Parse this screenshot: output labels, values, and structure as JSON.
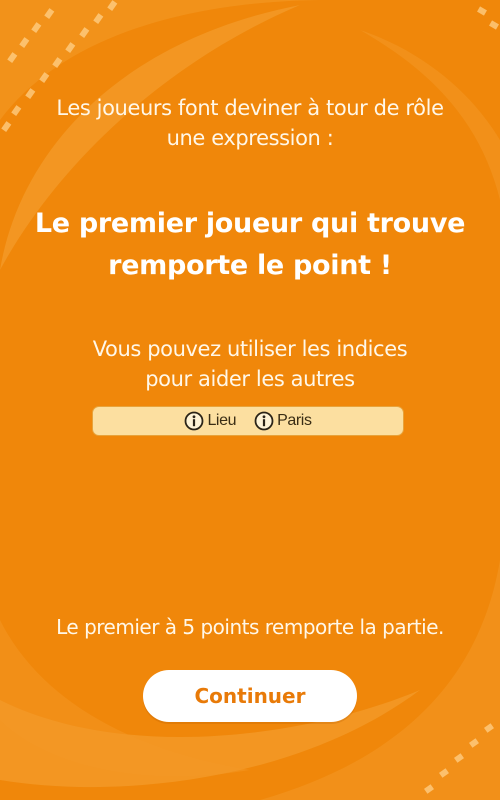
{
  "theme": {
    "background": "#f0870a",
    "accent": "#e87a08",
    "clue_bar_bg": "#fcdfa0"
  },
  "instructions": {
    "intro_line1": "Les joueurs font deviner à tour de rôle",
    "intro_line2": "une expression :",
    "headline_line1": "Le premier joueur qui trouve",
    "headline_line2": "remporte le point !",
    "hint_line1": "Vous pouvez utiliser les indices",
    "hint_line2": "pour aider les autres"
  },
  "clues": [
    {
      "icon": "info-icon",
      "label": "Lieu"
    },
    {
      "icon": "info-icon",
      "label": "Paris"
    }
  ],
  "rules_text": "Le premier à 5 points remporte la partie.",
  "continue_label": "Continuer"
}
